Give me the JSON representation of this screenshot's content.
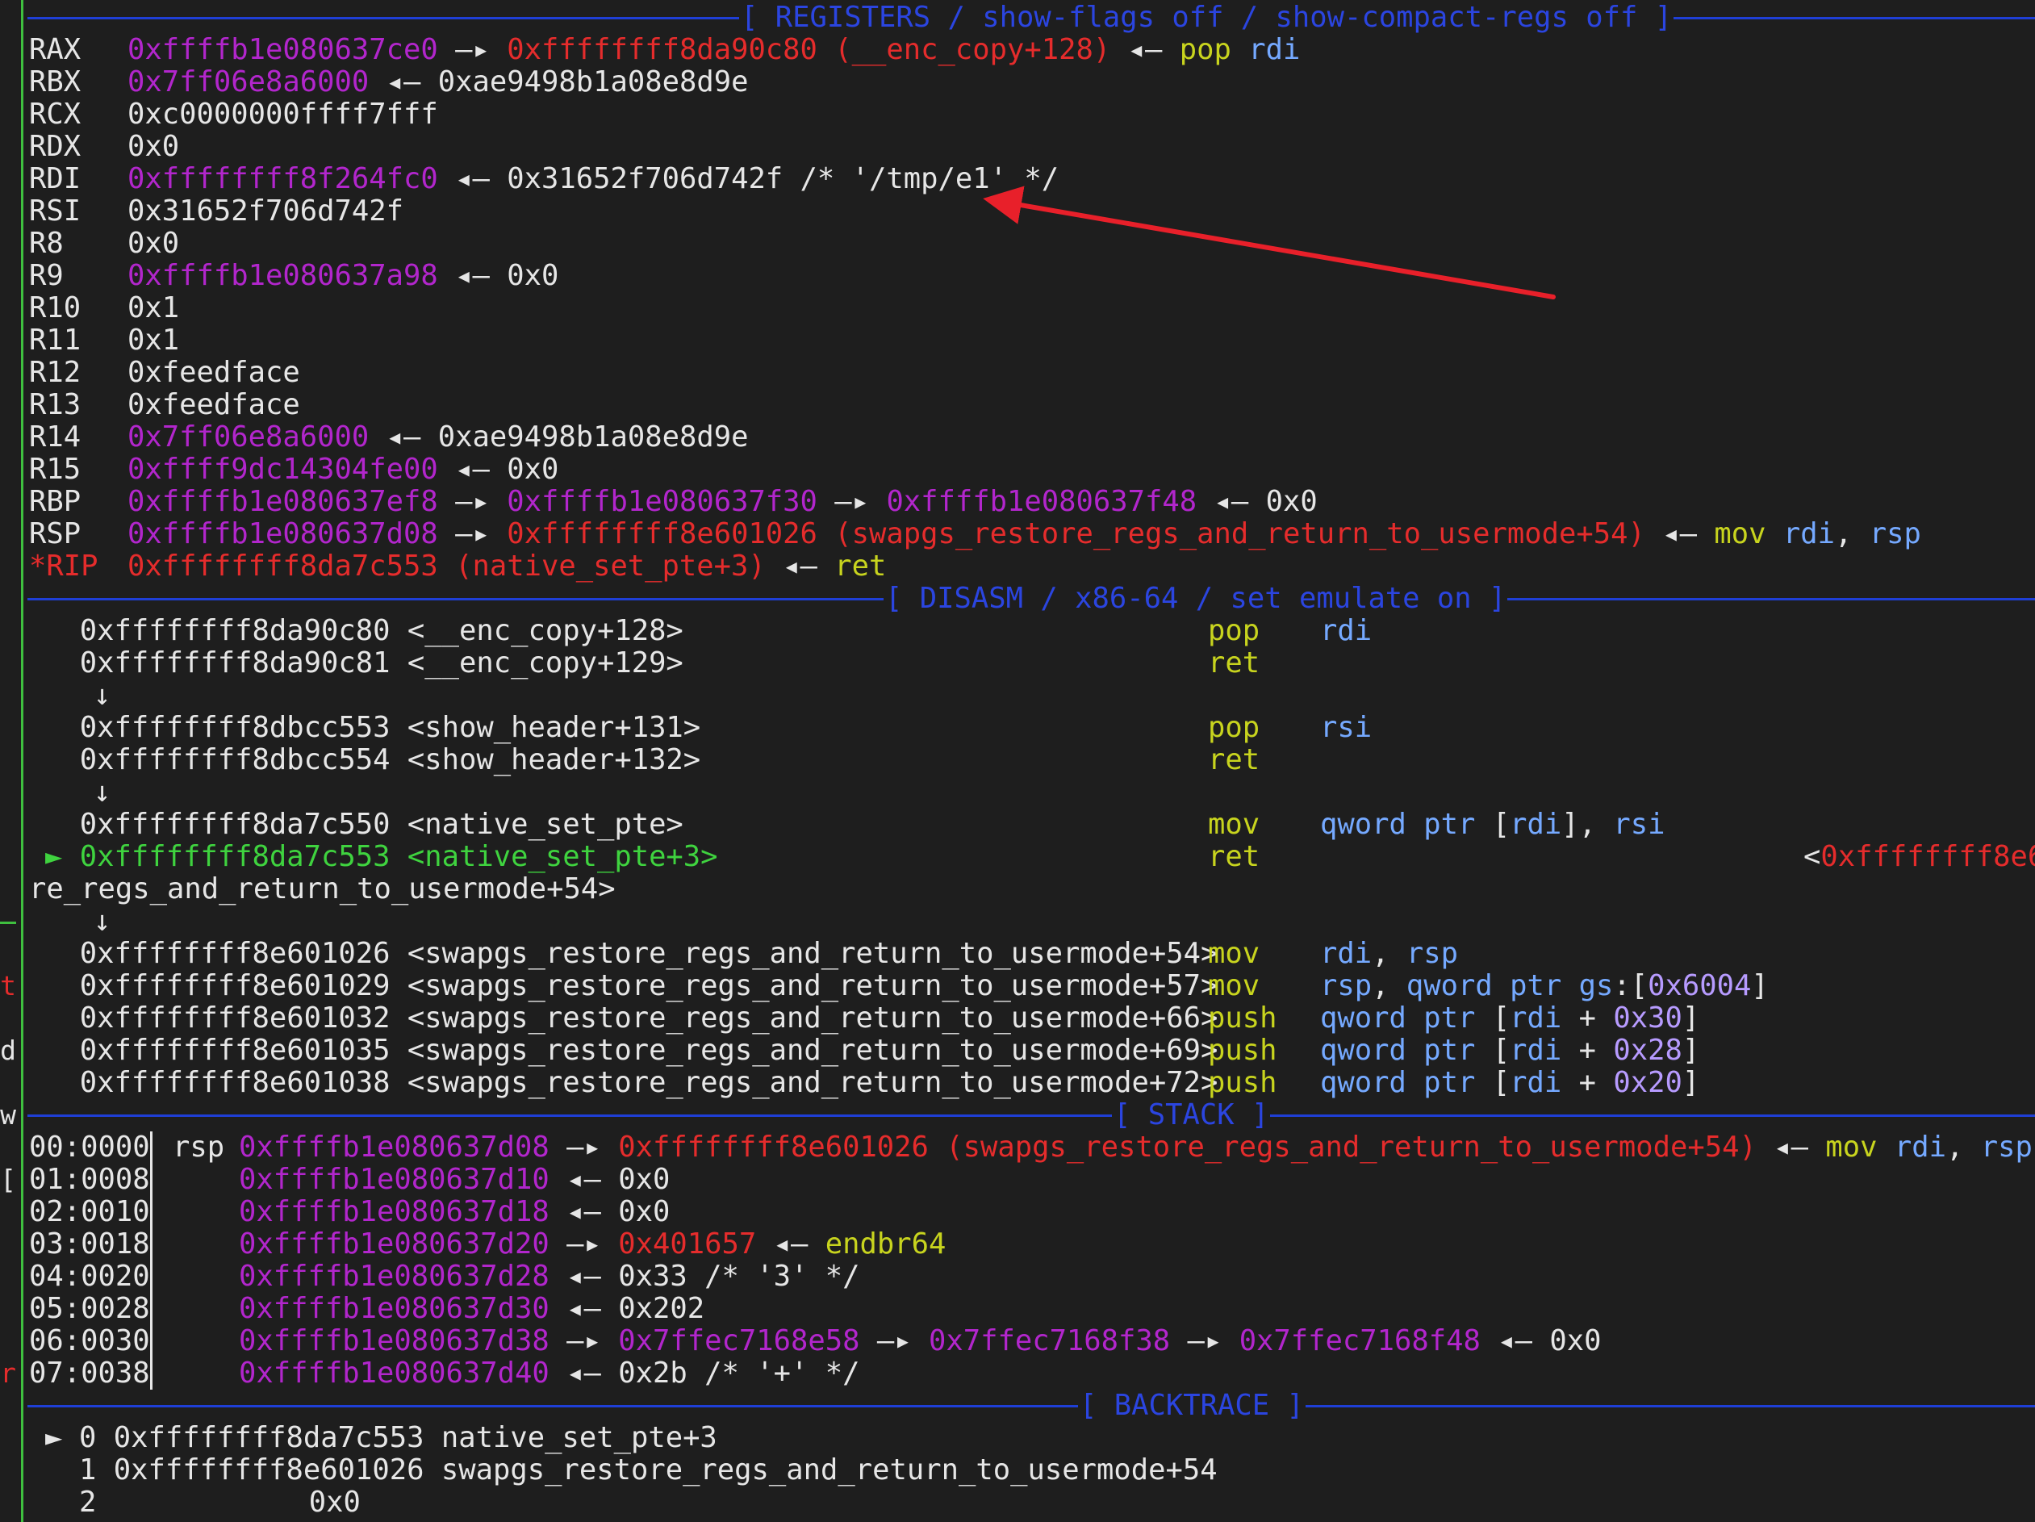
{
  "colors": {
    "background": "#1e1e1e",
    "address": "#b226cc",
    "code_pointer": "#e52c2c",
    "instruction": "#c8d41e",
    "register_operand": "#75a9ff",
    "immediate": "#b79bff",
    "current_line": "#3fd33f",
    "separator": "#1f3fd6",
    "arrow_annotation": "#e8202a"
  },
  "headers": {
    "registers": "[ REGISTERS / show-flags off / show-compact-regs off ]",
    "disasm": "[ DISASM / x86-64 / set emulate on ]",
    "stack": "[ STACK ]",
    "backtrace": "[ BACKTRACE ]"
  },
  "left_gutter": [
    "t",
    "d",
    "w",
    "[",
    "r"
  ],
  "registers": [
    {
      "name": "RAX",
      "addr": "0xffffb1e080637ce0",
      "a1": " —▸ ",
      "ptr": "0xffffffff8da90c80 (__enc_copy+128)",
      "a2": " ◂— ",
      "ins": "pop",
      "op": "rdi"
    },
    {
      "name": "RBX",
      "addr": "0x7ff06e8a6000",
      "a1": " ◂— ",
      "val": "0xae9498b1a08e8d9e"
    },
    {
      "name": "RCX",
      "val": "0xc0000000ffff7fff"
    },
    {
      "name": "RDX",
      "val": "0x0"
    },
    {
      "name": "RDI",
      "addr": "0xffffffff8f264fc0",
      "a1": " ◂— ",
      "val": "0x31652f706d742f /* '/tmp/e1' */"
    },
    {
      "name": "RSI",
      "val": "0x31652f706d742f"
    },
    {
      "name": "R8",
      "val": "0x0"
    },
    {
      "name": "R9",
      "addr": "0xffffb1e080637a98",
      "a1": " ◂— ",
      "val": "0x0"
    },
    {
      "name": "R10",
      "val": "0x1"
    },
    {
      "name": "R11",
      "val": "0x1"
    },
    {
      "name": "R12",
      "val": "0xfeedface"
    },
    {
      "name": "R13",
      "val": "0xfeedface"
    },
    {
      "name": "R14",
      "addr": "0x7ff06e8a6000",
      "a1": " ◂— ",
      "val": "0xae9498b1a08e8d9e"
    },
    {
      "name": "R15",
      "addr": "0xffff9dc14304fe00",
      "a1": " ◂— ",
      "val": "0x0"
    },
    {
      "name": "RBP",
      "addr": "0xffffb1e080637ef8",
      "a1": " —▸ ",
      "addr2": "0xffffb1e080637f30",
      "a2": " —▸ ",
      "addr3": "0xffffb1e080637f48",
      "a3": " ◂— ",
      "val": "0x0"
    },
    {
      "name": "RSP",
      "addr": "0xffffb1e080637d08",
      "a1": " —▸ ",
      "ptr": "0xffffffff8e601026 (swapgs_restore_regs_and_return_to_usermode+54)",
      "a2": " ◂— ",
      "ins": "mov",
      "op": "rdi",
      "comma": ", ",
      "op2": "rsp"
    },
    {
      "name": "*RIP",
      "ptr": "0xffffffff8da7c553 (native_set_pte+3)",
      "a2": " ◂— ",
      "ins": "ret"
    }
  ],
  "disasm": [
    {
      "addr": "0xffffffff8da90c80",
      "sym": "<__enc_copy+128>",
      "ins": "pop",
      "ops": "rdi"
    },
    {
      "addr": "0xffffffff8da90c81",
      "sym": "<__enc_copy+129>",
      "ins": "ret",
      "ops": ""
    },
    {
      "flow": "↓"
    },
    {
      "addr": "0xffffffff8dbcc553",
      "sym": "<show_header+131>",
      "ins": "pop",
      "ops": "rsi"
    },
    {
      "addr": "0xffffffff8dbcc554",
      "sym": "<show_header+132>",
      "ins": "ret",
      "ops": ""
    },
    {
      "flow": "↓"
    },
    {
      "addr": "0xffffffff8da7c550",
      "sym": "<native_set_pte>",
      "ins": "mov",
      "ops": "qword ptr [rdi], rsi"
    },
    {
      "current": true,
      "marker": "►",
      "addr": "0xffffffff8da7c553",
      "sym": "<native_set_pte+3>",
      "ins": "ret",
      "target": "<",
      "target_ptr": "0xffffffff8e6"
    },
    {
      "wrap": "re_regs_and_return_to_usermode+54>"
    },
    {
      "flow": "↓"
    },
    {
      "addr": "0xffffffff8e601026",
      "sym": "<swapgs_restore_regs_and_return_to_usermode+54>",
      "ins": "mov",
      "ops": "rdi, rsp"
    },
    {
      "addr": "0xffffffff8e601029",
      "sym": "<swapgs_restore_regs_and_return_to_usermode+57>",
      "ins": "mov",
      "ops": "rsp, qword ptr gs:[0x6004]"
    },
    {
      "addr": "0xffffffff8e601032",
      "sym": "<swapgs_restore_regs_and_return_to_usermode+66>",
      "ins": "push",
      "ops": "qword ptr [rdi + 0x30]"
    },
    {
      "addr": "0xffffffff8e601035",
      "sym": "<swapgs_restore_regs_and_return_to_usermode+69>",
      "ins": "push",
      "ops": "qword ptr [rdi + 0x28]"
    },
    {
      "addr": "0xffffffff8e601038",
      "sym": "<swapgs_restore_regs_and_return_to_usermode+72>",
      "ins": "push",
      "ops": "qword ptr [rdi + 0x20]"
    }
  ],
  "stack": [
    {
      "idx": "00:0000",
      "reg": "rsp",
      "addr": "0xffffb1e080637d08",
      "a1": " —▸ ",
      "ptr": "0xffffffff8e601026 (swapgs_restore_regs_and_return_to_usermode+54)",
      "a2": " ◂— ",
      "ins": "mov",
      "op": "rdi",
      "comma": ", ",
      "op2": "rsp"
    },
    {
      "idx": "01:0008",
      "addr": "0xffffb1e080637d10",
      "a1": " ◂— ",
      "val": "0x0"
    },
    {
      "idx": "02:0010",
      "addr": "0xffffb1e080637d18",
      "a1": " ◂— ",
      "val": "0x0"
    },
    {
      "idx": "03:0018",
      "addr": "0xffffb1e080637d20",
      "a1": " —▸ ",
      "ptr": "0x401657",
      "a2": " ◂— ",
      "ins": "endbr64"
    },
    {
      "idx": "04:0020",
      "addr": "0xffffb1e080637d28",
      "a1": " ◂— ",
      "val": "0x33 /* '3' */"
    },
    {
      "idx": "05:0028",
      "addr": "0xffffb1e080637d30",
      "a1": " ◂— ",
      "val": "0x202"
    },
    {
      "idx": "06:0030",
      "addr": "0xffffb1e080637d38",
      "a1": " —▸ ",
      "addr2": "0x7ffec7168e58",
      "a2": " —▸ ",
      "addr3": "0x7ffec7168f38",
      "a3": " —▸ ",
      "addr4": "0x7ffec7168f48",
      "a4": " ◂— ",
      "val": "0x0"
    },
    {
      "idx": "07:0038",
      "addr": "0xffffb1e080637d40",
      "a1": " ◂— ",
      "val": "0x2b /* '+' */"
    }
  ],
  "backtrace": [
    {
      "marker": "►",
      "num": "0",
      "addr": "0xffffffff8da7c553",
      "sym": "native_set_pte+3"
    },
    {
      "marker": "",
      "num": "1",
      "addr": "0xffffffff8e601026",
      "sym": "swapgs_restore_regs_and_return_to_usermode+54"
    },
    {
      "marker": "",
      "num": "2",
      "addr": "",
      "sym": "0x0"
    }
  ]
}
